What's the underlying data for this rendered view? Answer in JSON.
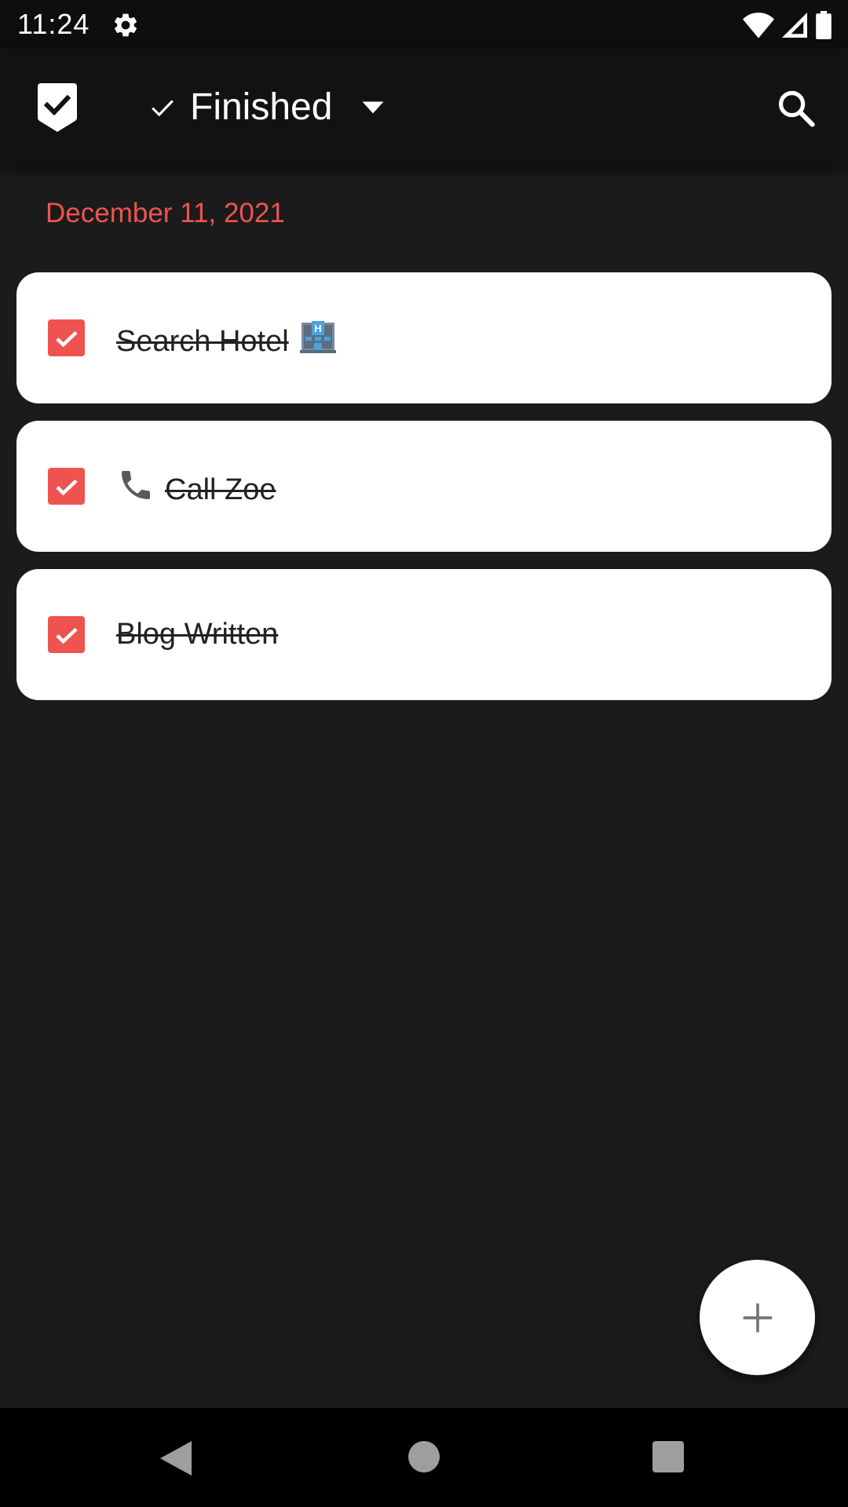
{
  "status_bar": {
    "time": "11:24",
    "settings_icon": "gear-icon",
    "wifi_icon": "wifi-icon",
    "signal_icon": "cell-signal-icon",
    "battery_icon": "battery-icon"
  },
  "app_bar": {
    "logo_icon": "shield-check-icon",
    "filter": {
      "label": "Finished",
      "check_icon": "check-icon",
      "dropdown_icon": "caret-down-icon"
    },
    "search_icon": "search-icon"
  },
  "date_header": "December 11, 2021",
  "tasks": [
    {
      "text": "Search Hotel",
      "trailing_emoji": "hotel-emoji",
      "completed": true
    },
    {
      "text": "Call Zoe",
      "leading_emoji": "telephone-emoji",
      "completed": true
    },
    {
      "text": "Blog Written",
      "completed": true
    }
  ],
  "fab": {
    "icon": "plus-icon"
  },
  "nav_bar": {
    "back_icon": "back-triangle-icon",
    "home_icon": "home-circle-icon",
    "recents_icon": "recents-square-icon"
  },
  "colors": {
    "accent": "#ef5350",
    "background": "#1b1b1b",
    "app_bar": "#121212",
    "card": "#ffffff"
  }
}
